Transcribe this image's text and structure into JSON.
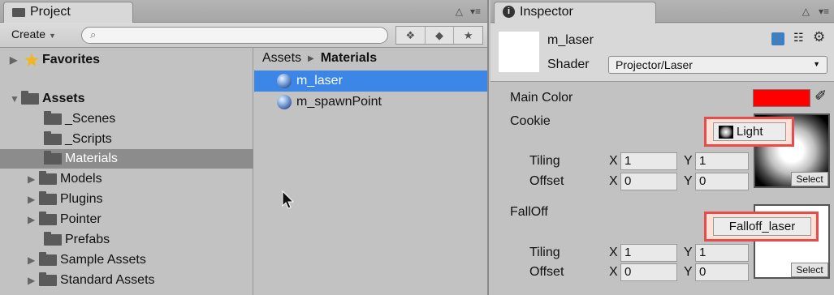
{
  "project": {
    "tab_label": "Project",
    "create_label": "Create",
    "search_placeholder": "",
    "favorites_label": "Favorites",
    "assets_label": "Assets",
    "folders": [
      "_Scenes",
      "_Scripts",
      "Materials",
      "Models",
      "Plugins",
      "Pointer",
      "Prefabs",
      "Sample Assets",
      "Standard Assets"
    ],
    "breadcrumb": [
      "Assets",
      "Materials"
    ],
    "files": [
      "m_laser",
      "m_spawnPoint"
    ]
  },
  "inspector": {
    "tab_label": "Inspector",
    "material_name": "m_laser",
    "shader_label": "Shader",
    "shader_value": "Projector/Laser",
    "main_color_label": "Main Color",
    "main_color": "#ff0000",
    "cookie_label": "Cookie",
    "cookie_texture": "Light",
    "falloff_label": "FallOff",
    "falloff_texture": "Falloff_laser",
    "tiling_label": "Tiling",
    "offset_label": "Offset",
    "x_label": "X",
    "y_label": "Y",
    "cookie_tiling": {
      "x": "1",
      "y": "1"
    },
    "cookie_offset": {
      "x": "0",
      "y": "0"
    },
    "falloff_tiling": {
      "x": "1",
      "y": "1"
    },
    "falloff_offset": {
      "x": "0",
      "y": "0"
    },
    "select_label": "Select"
  },
  "colors": {
    "selection_blue": "#3b86e6",
    "highlight_red": "#e74c4c"
  }
}
